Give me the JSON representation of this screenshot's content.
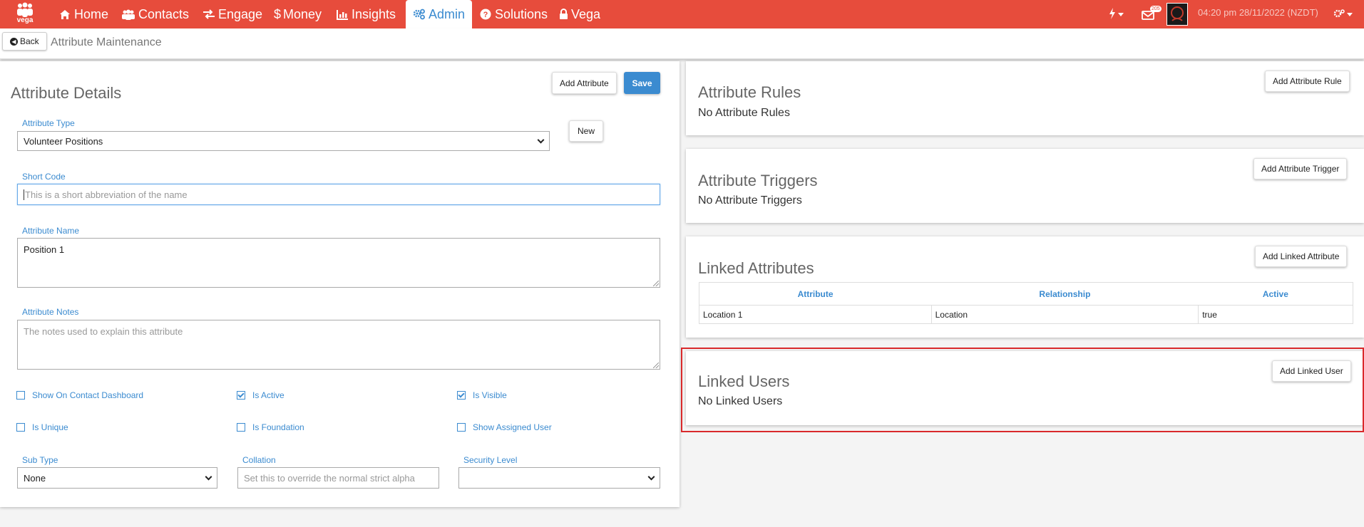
{
  "nav": {
    "logo_text": "vega",
    "items": [
      {
        "label": "Home",
        "icon": "home-icon"
      },
      {
        "label": "Contacts",
        "icon": "users-icon"
      },
      {
        "label": "Engage",
        "icon": "exchange-icon"
      },
      {
        "label": "Money",
        "icon": "dollar-icon"
      },
      {
        "label": "Insights",
        "icon": "bar-chart-icon"
      },
      {
        "label": "Admin",
        "icon": "gears-icon",
        "active": true
      },
      {
        "label": "Solutions",
        "icon": "question-circle-icon"
      },
      {
        "label": "Vega",
        "icon": "lock-icon"
      }
    ],
    "notification_count": "205",
    "datetime": "04:20 pm 28/11/2022 (NZDT)",
    "accent": "#e74c3c"
  },
  "subheader": {
    "back_label": "Back",
    "title": "Attribute Maintenance"
  },
  "details": {
    "title": "Attribute Details",
    "add_attribute_label": "Add Attribute",
    "save_label": "Save",
    "new_label": "New",
    "attribute_type_label": "Attribute Type",
    "attribute_type_value": "Volunteer Positions",
    "short_code_label": "Short Code",
    "short_code_placeholder": "This is a short abbreviation of the name",
    "attribute_name_label": "Attribute Name",
    "attribute_name_value": "Position 1",
    "notes_label": "Attribute Notes",
    "notes_placeholder": "The notes used to explain this attribute",
    "checkboxes": {
      "show_on_dashboard": {
        "label": "Show On Contact Dashboard",
        "checked": false
      },
      "is_active": {
        "label": "Is Active",
        "checked": true
      },
      "is_visible": {
        "label": "Is Visible",
        "checked": true
      },
      "is_unique": {
        "label": "Is Unique",
        "checked": false
      },
      "is_foundation": {
        "label": "Is Foundation",
        "checked": false
      },
      "show_assigned_user": {
        "label": "Show Assigned User",
        "checked": false
      }
    },
    "sub_type_label": "Sub Type",
    "sub_type_value": "None",
    "collation_label": "Collation",
    "collation_placeholder": "Set this to override the normal strict alpha",
    "security_level_label": "Security Level",
    "security_level_value": ""
  },
  "rules": {
    "title": "Attribute Rules",
    "empty_text": "No Attribute Rules",
    "add_label": "Add Attribute Rule"
  },
  "triggers": {
    "title": "Attribute Triggers",
    "empty_text": "No Attribute Triggers",
    "add_label": "Add Attribute Trigger"
  },
  "linked_attributes": {
    "title": "Linked Attributes",
    "add_label": "Add Linked Attribute",
    "columns": [
      "Attribute",
      "Relationship",
      "Active"
    ],
    "rows": [
      [
        "Location 1",
        "Location",
        "true"
      ]
    ]
  },
  "linked_users": {
    "title": "Linked Users",
    "empty_text": "No Linked Users",
    "add_label": "Add Linked User"
  }
}
